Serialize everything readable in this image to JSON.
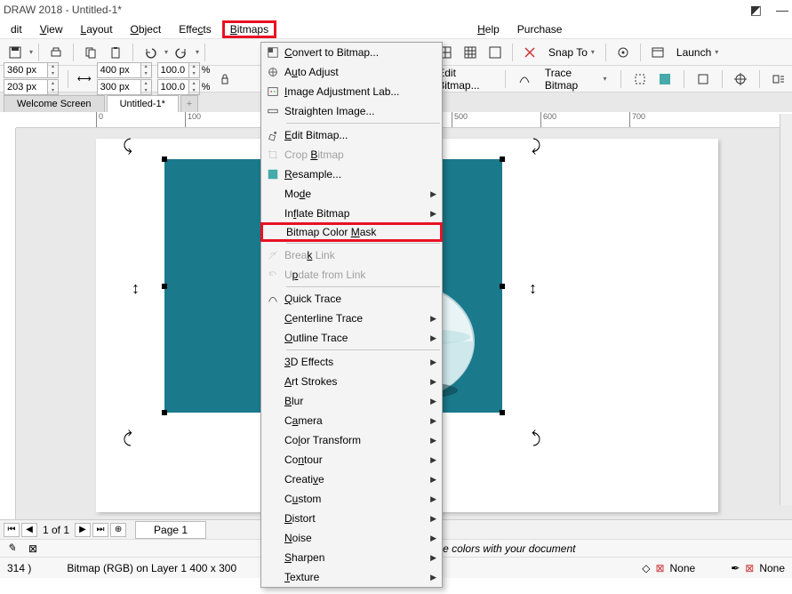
{
  "title": "DRAW 2018 - Untitled-1*",
  "menu": {
    "edit": "dit",
    "view": "View",
    "layout": "Layout",
    "object": "Object",
    "effects": "Effects",
    "bitmaps": "Bitmaps",
    "help": "Help",
    "purchase": "Purchase"
  },
  "pos": {
    "x": "360 px",
    "y": "203 px"
  },
  "size": {
    "w": "400 px",
    "h": "300 px"
  },
  "scale": {
    "x": "100.0",
    "y": "100.0"
  },
  "editbmp": "Edit Bitmap...",
  "tracebmp": "Trace Bitmap",
  "snap": "Snap To",
  "launch": "Launch",
  "tabs": {
    "welcome": "Welcome Screen",
    "doc": "Untitled-1*",
    "add": "+"
  },
  "ruler": {
    "t0": "0",
    "t1": "100",
    "t5": "500",
    "t6": "600",
    "t7": "700"
  },
  "dd": [
    {
      "k": "convert",
      "t": "Convert to Bitmap..."
    },
    {
      "k": "auto",
      "t": "Auto Adjust"
    },
    {
      "k": "ial",
      "t": "Image Adjustment Lab..."
    },
    {
      "k": "straight",
      "t": "Straighten Image..."
    },
    {
      "k": "sep"
    },
    {
      "k": "edit",
      "t": "Edit Bitmap..."
    },
    {
      "k": "crop",
      "t": "Crop Bitmap",
      "dis": true
    },
    {
      "k": "resample",
      "t": "Resample..."
    },
    {
      "k": "mode",
      "t": "Mode",
      "sub": true
    },
    {
      "k": "inflate",
      "t": "Inflate Bitmap",
      "sub": true
    },
    {
      "k": "mask",
      "t": "Bitmap Color Mask",
      "hl": true
    },
    {
      "k": "sep"
    },
    {
      "k": "break",
      "t": "Break Link",
      "dis": true
    },
    {
      "k": "update",
      "t": "Update from Link",
      "dis": true
    },
    {
      "k": "sep"
    },
    {
      "k": "quick",
      "t": "Quick Trace"
    },
    {
      "k": "center",
      "t": "Centerline Trace",
      "sub": true
    },
    {
      "k": "outline",
      "t": "Outline Trace",
      "sub": true
    },
    {
      "k": "sep"
    },
    {
      "k": "3d",
      "t": "3D Effects",
      "sub": true
    },
    {
      "k": "art",
      "t": "Art Strokes",
      "sub": true
    },
    {
      "k": "blur",
      "t": "Blur",
      "sub": true
    },
    {
      "k": "camera",
      "t": "Camera",
      "sub": true
    },
    {
      "k": "colort",
      "t": "Color Transform",
      "sub": true
    },
    {
      "k": "contour",
      "t": "Contour",
      "sub": true
    },
    {
      "k": "creative",
      "t": "Creative",
      "sub": true
    },
    {
      "k": "custom",
      "t": "Custom",
      "sub": true
    },
    {
      "k": "distort",
      "t": "Distort",
      "sub": true
    },
    {
      "k": "noise",
      "t": "Noise",
      "sub": true
    },
    {
      "k": "sharpen",
      "t": "Sharpen",
      "sub": true
    },
    {
      "k": "texture",
      "t": "Texture",
      "sub": true
    }
  ],
  "ddlabel": {
    "convert": "<u>C</u>onvert to Bitmap...",
    "auto": "A<u>u</u>to Adjust",
    "ial": "<u>I</u>mage Adjustment Lab...",
    "straight": "Strai<u>g</u>hten Image...",
    "edit": "<u>E</u>dit Bitmap...",
    "crop": "Crop <u>B</u>itmap",
    "resample": "<u>R</u>esample...",
    "mode": "Mo<u>d</u>e",
    "inflate": "In<u>f</u>late Bitmap",
    "mask": "Bitmap Color <u>M</u>ask",
    "break": "Brea<u>k</u> Link",
    "update": "U<u>p</u>date from Link",
    "quick": "<u>Q</u>uick Trace",
    "center": "<u>C</u>enterline Trace",
    "outline": "<u>O</u>utline Trace",
    "3d": "<u>3</u>D Effects",
    "art": "<u>A</u>rt Strokes",
    "blur": "<u>B</u>lur",
    "camera": "C<u>a</u>mera",
    "colort": "Co<u>l</u>or Transform",
    "contour": "Co<u>n</u>tour",
    "creative": "Creati<u>v</u>e",
    "custom": "C<u>u</u>stom",
    "distort": "<u>D</u>istort",
    "noise": "<u>N</u>oise",
    "sharpen": "<u>S</u>harpen",
    "texture": "<u>T</u>exture"
  },
  "pagenav": {
    "count": "1 of 1",
    "page": "Page 1"
  },
  "hint": "se colors with your document",
  "status": {
    "coord": "314 )",
    "layer": "Bitmap (RGB) on Layer 1 400 x 300",
    "fill": "None",
    "outline": "None"
  }
}
